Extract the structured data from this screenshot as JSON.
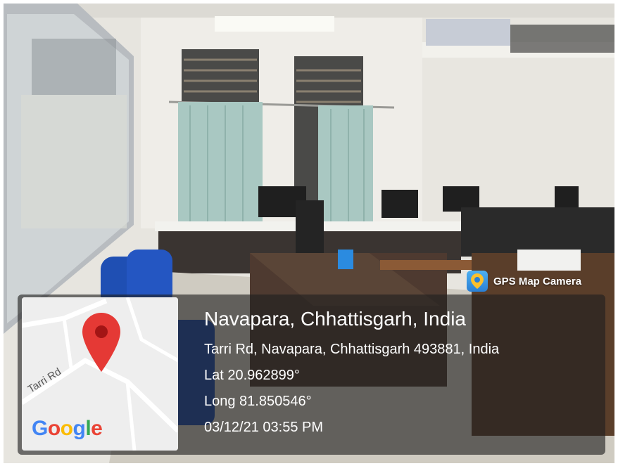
{
  "badge": {
    "label": "GPS Map Camera",
    "icon": "gps-map-camera-icon"
  },
  "location": {
    "title": "Navapara, Chhattisgarh, India",
    "address": "Tarri Rd, Navapara, Chhattisgarh 493881, India",
    "lat": "Lat 20.962899°",
    "long": "Long 81.850546°",
    "datetime": "03/12/21 03:55 PM"
  },
  "map": {
    "road_label": "Tarri Rd",
    "logo": "Google",
    "pin_color": "#e53935"
  }
}
